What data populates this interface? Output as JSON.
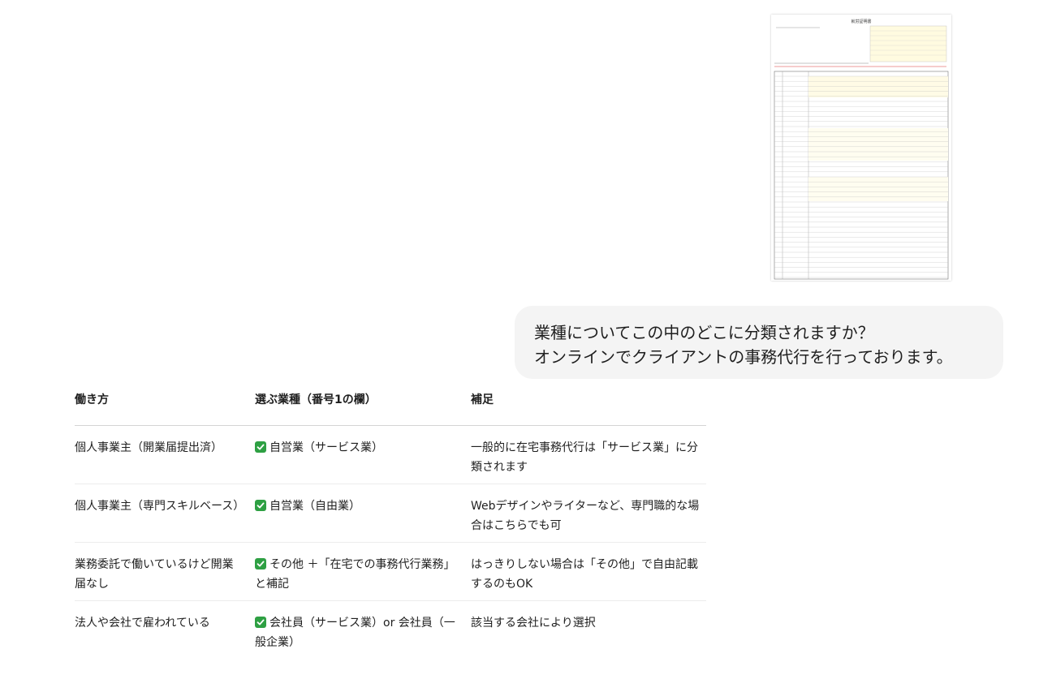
{
  "attachment": {
    "kind": "document-thumbnail",
    "form_title": "就労証明書"
  },
  "message": {
    "lines": [
      "業種についてこの中のどこに分類されますか？",
      "オンラインでクライアントの事務代行を行っております。"
    ]
  },
  "table": {
    "headers": [
      "働き方",
      "選ぶ業種（番号1の欄）",
      "補足"
    ],
    "check_icon": "check-mark-button-icon",
    "check_color": "#2ea043",
    "rows": [
      {
        "work_style": "個人事業主（開業届提出済）",
        "industry": "自営業（サービス業）",
        "note": "一般的に在宅事務代行は「サービス業」に分類されます"
      },
      {
        "work_style": "個人事業主（専門スキルベース）",
        "industry": "自営業（自由業）",
        "note": "Webデザインやライターなど、専門職的な場合はこちらでも可"
      },
      {
        "work_style": "業務委託で働いているけど開業届なし",
        "industry": "その他 ＋「在宅での事務代行業務」と補記",
        "note": "はっきりしない場合は「その他」で自由記載するのもOK"
      },
      {
        "work_style": "法人や会社で雇われている",
        "industry": "会社員（サービス業）or 会社員（一般企業）",
        "note": "該当する会社により選択"
      }
    ]
  }
}
